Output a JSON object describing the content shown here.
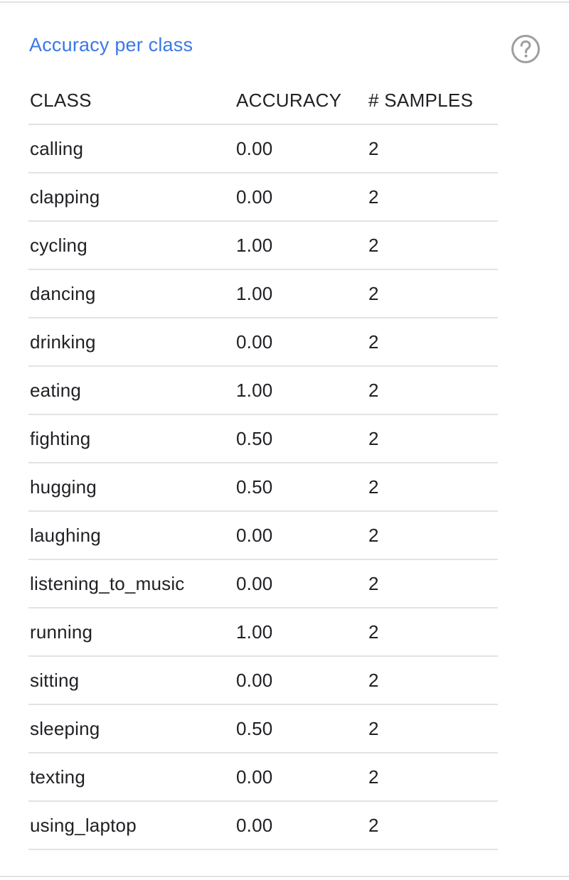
{
  "panel": {
    "title": "Accuracy per class",
    "help_icon": "help-circle-icon"
  },
  "table": {
    "columns": [
      "CLASS",
      "ACCURACY",
      "# SAMPLES"
    ],
    "rows": [
      {
        "class": "calling",
        "accuracy": "0.00",
        "samples": "2"
      },
      {
        "class": "clapping",
        "accuracy": "0.00",
        "samples": "2"
      },
      {
        "class": "cycling",
        "accuracy": "1.00",
        "samples": "2"
      },
      {
        "class": "dancing",
        "accuracy": "1.00",
        "samples": "2"
      },
      {
        "class": "drinking",
        "accuracy": "0.00",
        "samples": "2"
      },
      {
        "class": "eating",
        "accuracy": "1.00",
        "samples": "2"
      },
      {
        "class": "fighting",
        "accuracy": "0.50",
        "samples": "2"
      },
      {
        "class": "hugging",
        "accuracy": "0.50",
        "samples": "2"
      },
      {
        "class": "laughing",
        "accuracy": "0.00",
        "samples": "2"
      },
      {
        "class": "listening_to_music",
        "accuracy": "0.00",
        "samples": "2"
      },
      {
        "class": "running",
        "accuracy": "1.00",
        "samples": "2"
      },
      {
        "class": "sitting",
        "accuracy": "0.00",
        "samples": "2"
      },
      {
        "class": "sleeping",
        "accuracy": "0.50",
        "samples": "2"
      },
      {
        "class": "texting",
        "accuracy": "0.00",
        "samples": "2"
      },
      {
        "class": "using_laptop",
        "accuracy": "0.00",
        "samples": "2"
      }
    ]
  },
  "colors": {
    "title": "#3b78e7",
    "divider": "#e3e3e3",
    "icon": "#9e9e9e"
  }
}
